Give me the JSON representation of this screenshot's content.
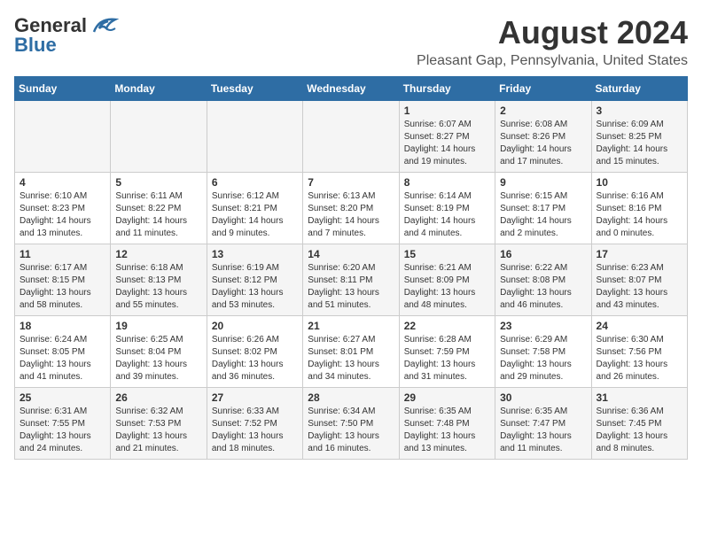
{
  "logo": {
    "general": "General",
    "blue": "Blue"
  },
  "title": "August 2024",
  "subtitle": "Pleasant Gap, Pennsylvania, United States",
  "weekdays": [
    "Sunday",
    "Monday",
    "Tuesday",
    "Wednesday",
    "Thursday",
    "Friday",
    "Saturday"
  ],
  "weeks": [
    [
      {
        "day": "",
        "info": ""
      },
      {
        "day": "",
        "info": ""
      },
      {
        "day": "",
        "info": ""
      },
      {
        "day": "",
        "info": ""
      },
      {
        "day": "1",
        "info": "Sunrise: 6:07 AM\nSunset: 8:27 PM\nDaylight: 14 hours\nand 19 minutes."
      },
      {
        "day": "2",
        "info": "Sunrise: 6:08 AM\nSunset: 8:26 PM\nDaylight: 14 hours\nand 17 minutes."
      },
      {
        "day": "3",
        "info": "Sunrise: 6:09 AM\nSunset: 8:25 PM\nDaylight: 14 hours\nand 15 minutes."
      }
    ],
    [
      {
        "day": "4",
        "info": "Sunrise: 6:10 AM\nSunset: 8:23 PM\nDaylight: 14 hours\nand 13 minutes."
      },
      {
        "day": "5",
        "info": "Sunrise: 6:11 AM\nSunset: 8:22 PM\nDaylight: 14 hours\nand 11 minutes."
      },
      {
        "day": "6",
        "info": "Sunrise: 6:12 AM\nSunset: 8:21 PM\nDaylight: 14 hours\nand 9 minutes."
      },
      {
        "day": "7",
        "info": "Sunrise: 6:13 AM\nSunset: 8:20 PM\nDaylight: 14 hours\nand 7 minutes."
      },
      {
        "day": "8",
        "info": "Sunrise: 6:14 AM\nSunset: 8:19 PM\nDaylight: 14 hours\nand 4 minutes."
      },
      {
        "day": "9",
        "info": "Sunrise: 6:15 AM\nSunset: 8:17 PM\nDaylight: 14 hours\nand 2 minutes."
      },
      {
        "day": "10",
        "info": "Sunrise: 6:16 AM\nSunset: 8:16 PM\nDaylight: 14 hours\nand 0 minutes."
      }
    ],
    [
      {
        "day": "11",
        "info": "Sunrise: 6:17 AM\nSunset: 8:15 PM\nDaylight: 13 hours\nand 58 minutes."
      },
      {
        "day": "12",
        "info": "Sunrise: 6:18 AM\nSunset: 8:13 PM\nDaylight: 13 hours\nand 55 minutes."
      },
      {
        "day": "13",
        "info": "Sunrise: 6:19 AM\nSunset: 8:12 PM\nDaylight: 13 hours\nand 53 minutes."
      },
      {
        "day": "14",
        "info": "Sunrise: 6:20 AM\nSunset: 8:11 PM\nDaylight: 13 hours\nand 51 minutes."
      },
      {
        "day": "15",
        "info": "Sunrise: 6:21 AM\nSunset: 8:09 PM\nDaylight: 13 hours\nand 48 minutes."
      },
      {
        "day": "16",
        "info": "Sunrise: 6:22 AM\nSunset: 8:08 PM\nDaylight: 13 hours\nand 46 minutes."
      },
      {
        "day": "17",
        "info": "Sunrise: 6:23 AM\nSunset: 8:07 PM\nDaylight: 13 hours\nand 43 minutes."
      }
    ],
    [
      {
        "day": "18",
        "info": "Sunrise: 6:24 AM\nSunset: 8:05 PM\nDaylight: 13 hours\nand 41 minutes."
      },
      {
        "day": "19",
        "info": "Sunrise: 6:25 AM\nSunset: 8:04 PM\nDaylight: 13 hours\nand 39 minutes."
      },
      {
        "day": "20",
        "info": "Sunrise: 6:26 AM\nSunset: 8:02 PM\nDaylight: 13 hours\nand 36 minutes."
      },
      {
        "day": "21",
        "info": "Sunrise: 6:27 AM\nSunset: 8:01 PM\nDaylight: 13 hours\nand 34 minutes."
      },
      {
        "day": "22",
        "info": "Sunrise: 6:28 AM\nSunset: 7:59 PM\nDaylight: 13 hours\nand 31 minutes."
      },
      {
        "day": "23",
        "info": "Sunrise: 6:29 AM\nSunset: 7:58 PM\nDaylight: 13 hours\nand 29 minutes."
      },
      {
        "day": "24",
        "info": "Sunrise: 6:30 AM\nSunset: 7:56 PM\nDaylight: 13 hours\nand 26 minutes."
      }
    ],
    [
      {
        "day": "25",
        "info": "Sunrise: 6:31 AM\nSunset: 7:55 PM\nDaylight: 13 hours\nand 24 minutes."
      },
      {
        "day": "26",
        "info": "Sunrise: 6:32 AM\nSunset: 7:53 PM\nDaylight: 13 hours\nand 21 minutes."
      },
      {
        "day": "27",
        "info": "Sunrise: 6:33 AM\nSunset: 7:52 PM\nDaylight: 13 hours\nand 18 minutes."
      },
      {
        "day": "28",
        "info": "Sunrise: 6:34 AM\nSunset: 7:50 PM\nDaylight: 13 hours\nand 16 minutes."
      },
      {
        "day": "29",
        "info": "Sunrise: 6:35 AM\nSunset: 7:48 PM\nDaylight: 13 hours\nand 13 minutes."
      },
      {
        "day": "30",
        "info": "Sunrise: 6:35 AM\nSunset: 7:47 PM\nDaylight: 13 hours\nand 11 minutes."
      },
      {
        "day": "31",
        "info": "Sunrise: 6:36 AM\nSunset: 7:45 PM\nDaylight: 13 hours\nand 8 minutes."
      }
    ]
  ]
}
